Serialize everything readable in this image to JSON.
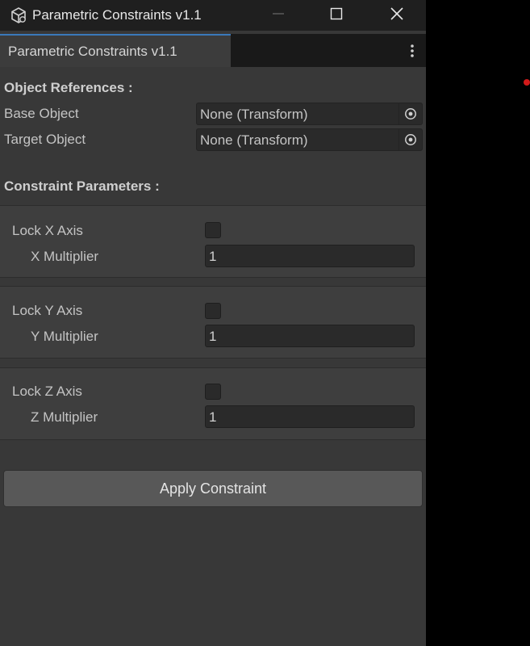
{
  "window": {
    "title": "Parametric Constraints v1.1"
  },
  "tab": {
    "label": "Parametric Constraints v1.1"
  },
  "object_refs": {
    "heading": "Object References :",
    "fields": [
      {
        "label": "Base Object",
        "value": "None (Transform)"
      },
      {
        "label": "Target Object",
        "value": "None (Transform)"
      }
    ]
  },
  "constraints": {
    "heading": "Constraint Parameters :",
    "groups": [
      {
        "lock_label": "Lock X Axis",
        "lock_checked": false,
        "mult_label": "X Multiplier",
        "mult_value": "1"
      },
      {
        "lock_label": "Lock Y Axis",
        "lock_checked": false,
        "mult_label": "Y Multiplier",
        "mult_value": "1"
      },
      {
        "lock_label": "Lock Z Axis",
        "lock_checked": false,
        "mult_label": "Z Multiplier",
        "mult_value": "1"
      }
    ]
  },
  "actions": {
    "apply_label": "Apply Constraint"
  },
  "icons": {
    "app": "unity-cube-icon",
    "minimize": "minimize-icon",
    "maximize": "maximize-icon",
    "close": "close-icon",
    "menu": "kebab-menu-icon",
    "picker": "object-picker-icon"
  },
  "colors": {
    "panel_bg": "#383838",
    "titlebar_bg": "#1f1f1f",
    "tab_accent": "#3a79bb",
    "field_bg": "#2a2a2a",
    "button_bg": "#585858"
  }
}
